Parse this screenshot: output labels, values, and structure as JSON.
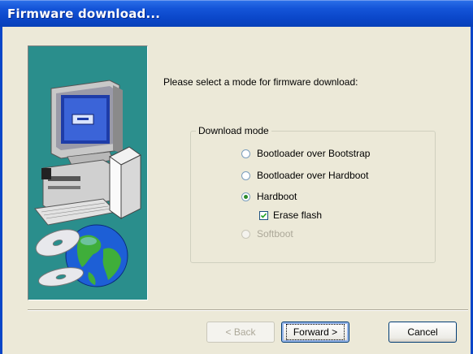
{
  "window": {
    "title": "Firmware download..."
  },
  "prompt": "Please select a mode for firmware download:",
  "group": {
    "legend": "Download mode",
    "options": [
      {
        "label": "Bootloader over Bootstrap",
        "checked": false,
        "enabled": true
      },
      {
        "label": "Bootloader over Hardboot",
        "checked": false,
        "enabled": true
      },
      {
        "label": "Hardboot",
        "checked": true,
        "enabled": true
      },
      {
        "label": "Softboot",
        "checked": false,
        "enabled": false
      }
    ],
    "erase_flash": {
      "label": "Erase flash",
      "checked": true
    }
  },
  "buttons": {
    "back": "< Back",
    "forward": "Forward >",
    "cancel": "Cancel"
  },
  "colors": {
    "titlebar": "#0a46c8",
    "dialog_bg": "#ece9d8",
    "illustration_bg": "#2a8e8c"
  },
  "icons": [
    "computer-illustration",
    "globe-icon",
    "cd-disc-icon"
  ]
}
